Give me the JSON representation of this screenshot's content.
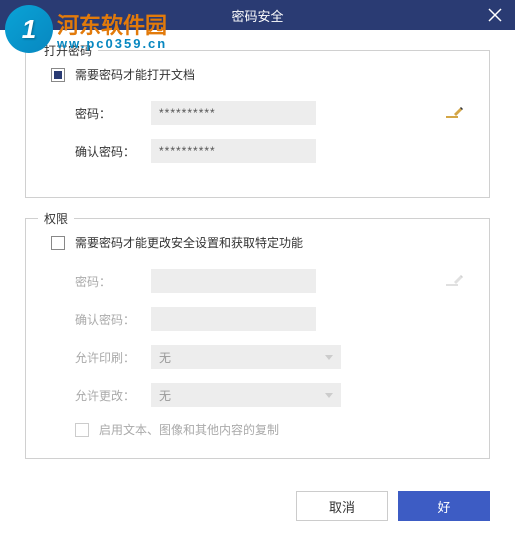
{
  "titlebar": {
    "title": "密码安全"
  },
  "watermark": {
    "brand": "河东软件园",
    "url": "ww.pc0359.cn",
    "logo_letter": "1"
  },
  "section_open": {
    "legend": "打开密码",
    "checkbox_label": "需要密码才能打开文档",
    "checked": true,
    "password_label": "密码：",
    "password_value": "**********",
    "confirm_label": "确认密码：",
    "confirm_value": "**********"
  },
  "section_perm": {
    "legend": "权限",
    "checkbox_label": "需要密码才能更改安全设置和获取特定功能",
    "checked": false,
    "password_label": "密码：",
    "password_value": "",
    "confirm_label": "确认密码：",
    "confirm_value": "",
    "print_label": "允许印刷：",
    "print_value": "无",
    "change_label": "允许更改：",
    "change_value": "无",
    "copy_label": "启用文本、图像和其他内容的复制"
  },
  "footer": {
    "cancel": "取消",
    "ok": "好"
  }
}
